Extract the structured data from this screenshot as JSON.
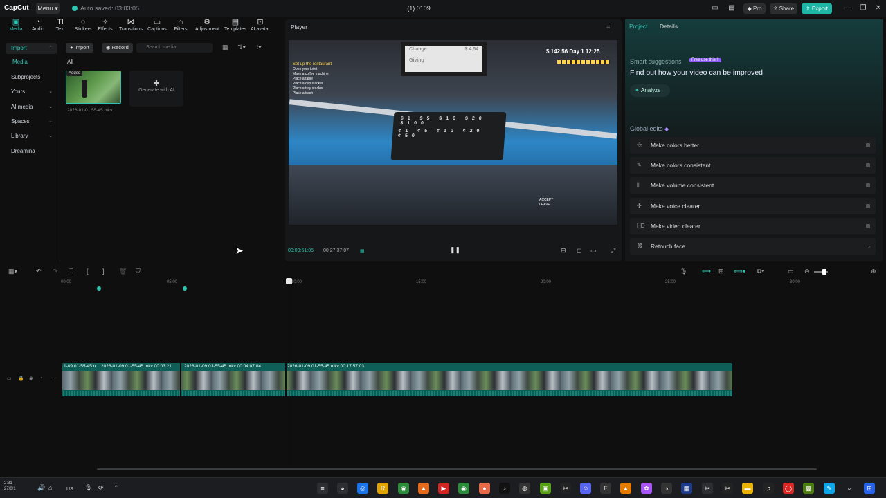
{
  "titlebar": {
    "logo": "CapCut",
    "menu_label": "Menu",
    "autosave_text": "Auto saved: 03:03:05",
    "project_title": "(1) 0109",
    "pro_label": "Pro",
    "share_label": "Share",
    "export_label": "Export"
  },
  "toolbar": {
    "items": [
      {
        "label": "Media",
        "icon": "media-icon"
      },
      {
        "label": "Audio",
        "icon": "audio-icon"
      },
      {
        "label": "Text",
        "icon": "text-icon"
      },
      {
        "label": "Stickers",
        "icon": "stickers-icon"
      },
      {
        "label": "Effects",
        "icon": "effects-icon"
      },
      {
        "label": "Transitions",
        "icon": "transitions-icon"
      },
      {
        "label": "Captions",
        "icon": "captions-icon"
      },
      {
        "label": "Filters",
        "icon": "filters-icon"
      },
      {
        "label": "Adjustment",
        "icon": "adjustment-icon"
      },
      {
        "label": "Templates",
        "icon": "templates-icon"
      },
      {
        "label": "AI avatar",
        "icon": "ai-avatar-icon"
      }
    ]
  },
  "leftnav": {
    "items": [
      {
        "label": "Import"
      },
      {
        "label": "Media"
      },
      {
        "label": "Subprojects"
      },
      {
        "label": "Yours"
      },
      {
        "label": "AI media"
      },
      {
        "label": "Spaces"
      },
      {
        "label": "Library"
      },
      {
        "label": "Dreamina"
      }
    ]
  },
  "media": {
    "import_label": "Import",
    "record_label": "Record",
    "search_placeholder": "Search media",
    "filter_all": "All",
    "thumb_badge": "Added",
    "thumb_name": "2026-01-0...55-45.mkv",
    "generate_label": "Generate with AI"
  },
  "player": {
    "title": "Player",
    "time_current": "00:09:51:05",
    "time_total": "00:27:37:07",
    "hud_money": "$ 142.56  Day 1  12:25",
    "panel_line1": "Change",
    "panel_value1": "$ 4.54",
    "panel_line2": "Giving",
    "hud_task_title": "Set up the restaurant",
    "hud_tasks": [
      "Open your toilet",
      "Make a coffee machine",
      "Place a table",
      "Place a cup stacker",
      "Place a tray stacker",
      "Place a trash"
    ],
    "prompt_accept": "ACCEPT",
    "prompt_leave": "LEAVE",
    "drawer_labels": [
      "$1",
      "$5",
      "$10",
      "$20",
      "$100",
      "¢1",
      "¢5",
      "¢10",
      "¢20",
      "¢50"
    ]
  },
  "right_panel": {
    "tab_project": "Project",
    "tab_details": "Details",
    "smart_title": "Smart suggestions",
    "smart_badge": "Free use this !!",
    "smart_heading": "Find out how your video can be improved",
    "analyze_label": "Analyze",
    "global_title": "Global edits",
    "edits": [
      {
        "label": "Make colors better",
        "icon": "magic-wand-icon"
      },
      {
        "label": "Make colors consistent",
        "icon": "color-brush-icon"
      },
      {
        "label": "Make volume consistent",
        "icon": "volume-bars-icon"
      },
      {
        "label": "Make voice clearer",
        "icon": "voice-wave-icon"
      },
      {
        "label": "Make video clearer",
        "icon": "hd-icon"
      },
      {
        "label": "Retouch face",
        "icon": "retouch-icon"
      }
    ]
  },
  "timeline": {
    "ruler_ticks": [
      "00:00",
      "05:00",
      "10:00",
      "15:00",
      "20:00",
      "25:00",
      "30:00"
    ],
    "clips": [
      {
        "label": "1-09 01-55-45.n"
      },
      {
        "label": "2026-01-09 01-55-45.mkv  00:03:21"
      },
      {
        "label": "2026-01-09 01-55-45.mkv  00:04:07:04"
      },
      {
        "label": "2026-01-09 01-55-45.mkv  00:17:57:03"
      }
    ]
  },
  "taskbar": {
    "lang": "US",
    "sys_left_top": "2:31",
    "sys_left_bot": "27/0/1",
    "apps": [
      "taskview",
      "steam",
      "edge",
      "rockstar",
      "chrome",
      "affinity",
      "youtube",
      "chrome-2",
      "mic",
      "tiktok",
      "obs",
      "nvidia",
      "capcut",
      "discord",
      "epic",
      "vlc",
      "multi",
      "github",
      "steam-2",
      "capcut-2",
      "folder",
      "music",
      "minecraft",
      "paint",
      "search",
      "start"
    ]
  },
  "colors": {
    "accent": "#2fc4b2",
    "export_btn": "#1fb5a6",
    "badge_purple": "#8b5cf6",
    "clip_track": "#0d5f58"
  }
}
